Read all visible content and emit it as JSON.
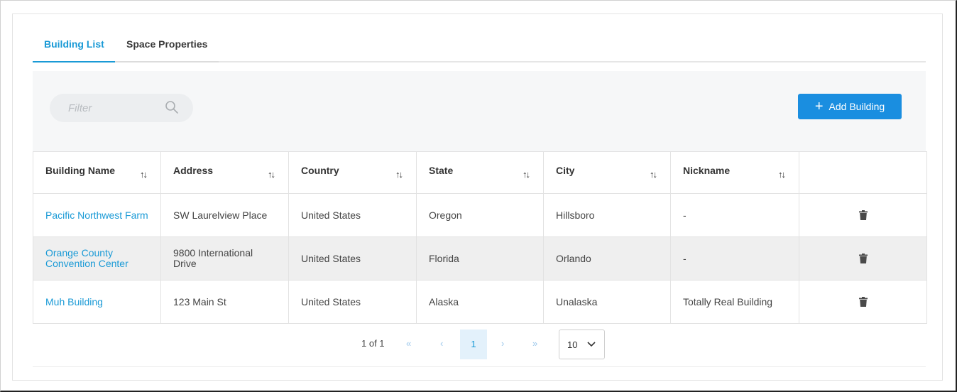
{
  "tabs": [
    {
      "label": "Building List",
      "active": true
    },
    {
      "label": "Space Properties",
      "active": false
    }
  ],
  "toolbar": {
    "filter_placeholder": "Filter",
    "add_button_label": "Add Building",
    "add_icon": "plus-icon",
    "search_icon": "search-icon"
  },
  "table": {
    "columns": [
      "Building Name",
      "Address",
      "Country",
      "State",
      "City",
      "Nickname",
      ""
    ],
    "rows": [
      {
        "name": "Pacific Northwest Farm",
        "address": "SW Laurelview Place",
        "country": "United States",
        "state": "Oregon",
        "city": "Hillsboro",
        "nickname": "-"
      },
      {
        "name": "Orange County Convention Center",
        "address": "9800 International Drive",
        "country": "United States",
        "state": "Florida",
        "city": "Orlando",
        "nickname": "-"
      },
      {
        "name": "Muh Building",
        "address": "123 Main St",
        "country": "United States",
        "state": "Alaska",
        "city": "Unalaska",
        "nickname": "Totally Real Building"
      }
    ]
  },
  "pagination": {
    "info": "1 of 1",
    "first": "«",
    "prev": "‹",
    "current_page": "1",
    "next": "›",
    "last": "»",
    "page_size": "10"
  },
  "colors": {
    "accent": "#1a9ad6",
    "button": "#1a8ee0",
    "toolbar_bg": "#f6f7f8",
    "alt_row": "#efefef"
  }
}
